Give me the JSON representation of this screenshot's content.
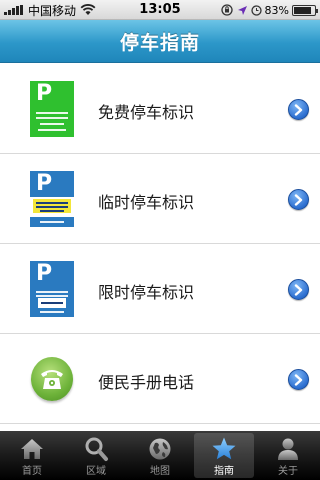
{
  "status_bar": {
    "carrier": "中国移动",
    "time": "13:05",
    "battery": "83%",
    "battery_level": 0.83
  },
  "nav": {
    "title": "停车指南"
  },
  "list": {
    "items": [
      {
        "label": "免费停车标识",
        "icon": "free-parking-sign-icon"
      },
      {
        "label": "临时停车标识",
        "icon": "temporary-parking-sign-icon"
      },
      {
        "label": "限时停车标识",
        "icon": "time-limited-parking-sign-icon"
      },
      {
        "label": "便民手册电话",
        "icon": "telephone-icon"
      }
    ],
    "sign_letter": "P"
  },
  "tabs": [
    {
      "label": "首页",
      "icon": "home-icon"
    },
    {
      "label": "区域",
      "icon": "search-icon"
    },
    {
      "label": "地图",
      "icon": "globe-icon"
    },
    {
      "label": "指南",
      "icon": "star-icon",
      "active": true
    },
    {
      "label": "关于",
      "icon": "person-icon"
    }
  ],
  "colors": {
    "nav_gradient_top": "#6cc4e6",
    "nav_gradient_bottom": "#1f86ba",
    "free_sign_green": "#2fc02f",
    "sign_blue": "#2a7ac0",
    "temp_sign_yellow": "#f3e63a",
    "phone_green": "#6eb33a",
    "tab_active_star": "#3a9ae0"
  }
}
